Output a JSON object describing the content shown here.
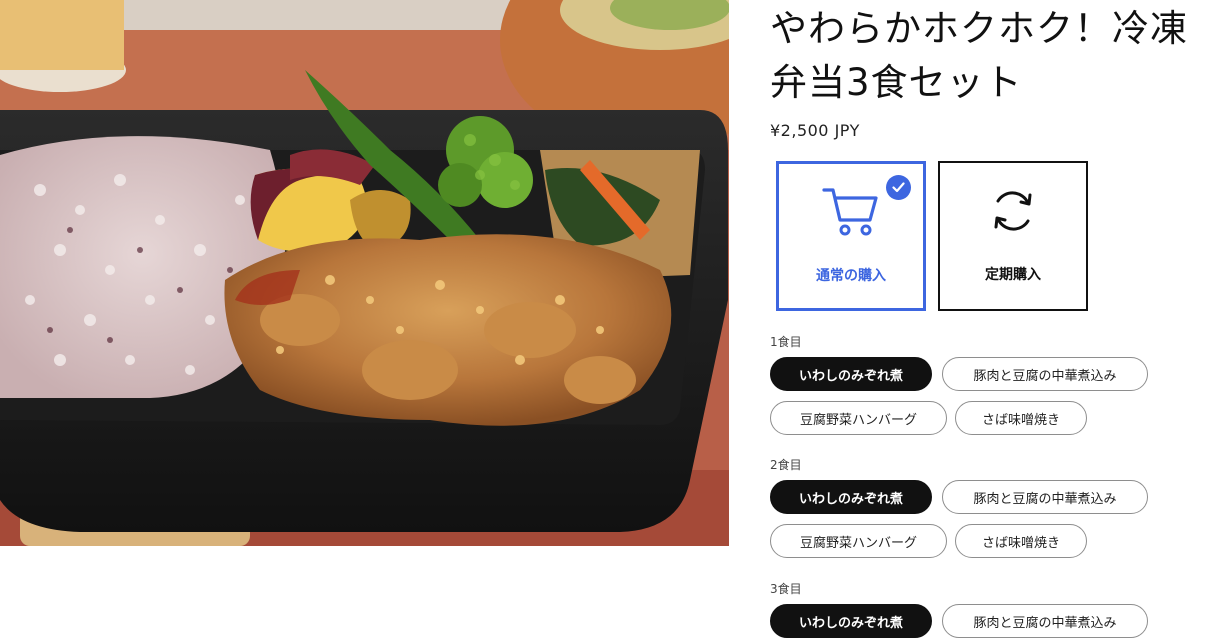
{
  "product": {
    "title": "やわらかホクホク！冷凍弁当3食セット",
    "price": "¥2,500 JPY"
  },
  "purchase_types": [
    {
      "label": "通常の購入",
      "icon": "cart-icon",
      "selected": true
    },
    {
      "label": "定期購入",
      "icon": "refresh-icon",
      "selected": false
    }
  ],
  "meals": [
    {
      "label": "1食目",
      "options": [
        "いわしのみぞれ煮",
        "豚肉と豆腐の中華煮込み",
        "豆腐野菜ハンバーグ",
        "さば味噌焼き"
      ],
      "selected": "いわしのみぞれ煮"
    },
    {
      "label": "2食目",
      "options": [
        "いわしのみぞれ煮",
        "豚肉と豆腐の中華煮込み",
        "豆腐野菜ハンバーグ",
        "さば味噌焼き"
      ],
      "selected": "いわしのみぞれ煮"
    },
    {
      "label": "3食目",
      "options": [
        "いわしのみぞれ煮",
        "豚肉と豆腐の中華煮込み"
      ],
      "selected": "いわしのみぞれ煮"
    }
  ],
  "colors": {
    "accent": "#3d66e0",
    "selected_chip": "#111111"
  }
}
